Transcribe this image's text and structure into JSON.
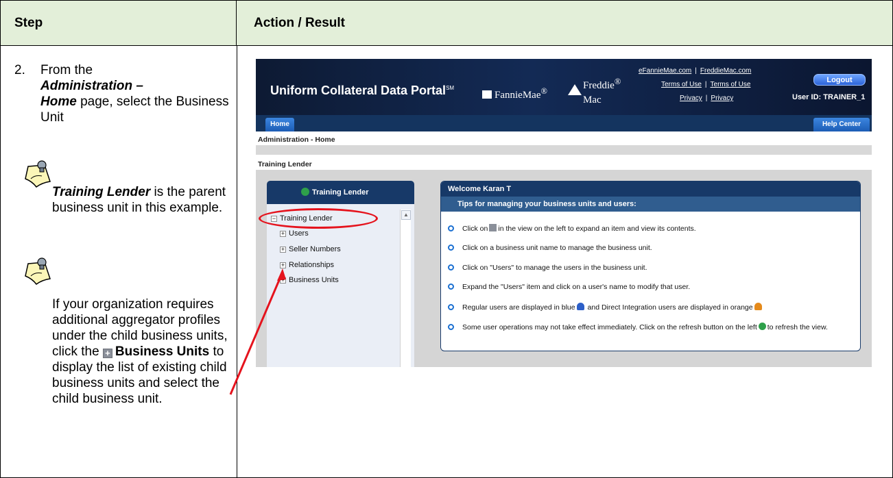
{
  "table": {
    "step_header": "Step",
    "action_header": "Action / Result",
    "step_number": "2.",
    "step_text_1": "From the",
    "step_text_admin": "Administration –",
    "step_text_home": "Home",
    "step_text_2": "page, select the Business Unit",
    "note1_bold": "Training Lender",
    "note1_text": "is the parent business unit in this example.",
    "note2_text_1": "If your organization requires additional aggregator profiles under the child business units, click the",
    "note2_bold": "Business Units",
    "note2_text_2": "to display the list of existing child business units and select the child business unit."
  },
  "portal": {
    "title": "Uniform Collateral Data Portal",
    "title_mark": "SM",
    "fannie": "FannieMae",
    "freddie_1": "Freddie",
    "freddie_2": "Mac",
    "link_efannie": "eFannieMae.com",
    "link_freddie": "FreddieMac.com",
    "link_terms_1": "Terms of Use",
    "link_terms_2": "Terms of Use",
    "link_privacy_1": "Privacy",
    "link_privacy_2": "Privacy",
    "logout": "Logout",
    "user_id": "User ID: TRAINER_1",
    "tab_home": "Home",
    "tab_help": "Help Center",
    "breadcrumb": "Administration - Home",
    "lender_bar": "Training Lender",
    "left_header": "Training Lender",
    "tree": [
      "Training Lender",
      "Users",
      "Seller Numbers",
      "Relationships",
      "Business Units"
    ],
    "welcome_title": "Welcome Karan T",
    "tips_title": "Tips for managing your business units and users:",
    "tip1_a": "Click on",
    "tip1_b": "in the view on the left to expand an item and view its contents.",
    "tip2": "Click on a business unit name to manage the business unit.",
    "tip3": "Click on \"Users\" to manage the users in the business unit.",
    "tip4": "Expand the \"Users\" item and click on a user's name to modify that user.",
    "tip5_a": "Regular users are displayed in blue",
    "tip5_b": "and Direct Integration users are displayed in orange",
    "tip6_a": "Some user operations may not take effect immediately. Click on the refresh button on the left",
    "tip6_b": "to refresh the view."
  },
  "colors": {
    "header_fill": "#e3efd9",
    "annotation": "#e5131d",
    "portal_navy": "#173968"
  }
}
